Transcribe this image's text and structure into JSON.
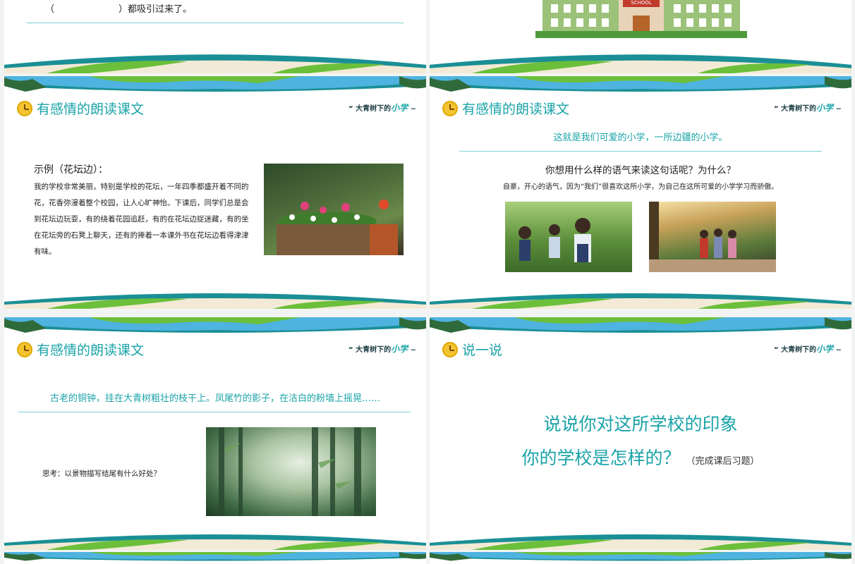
{
  "brand": {
    "prefix": "大青树下的",
    "accent": "小学"
  },
  "colors": {
    "teal": "#1aa3a8",
    "sky": "#4fb3e0",
    "leaf": "#6bbf3a",
    "sand": "#f2ead6"
  },
  "prev_slide": {
    "text": "（　　　　　　　）都吸引过来了。"
  },
  "slide1": {
    "title": "有感情的朗读课文",
    "example_title": "示例（花坛边）：",
    "example_body": "我的学校非常美丽，特别是学校的花坛，一年四季都盛开着不同的花，花香弥漫着整个校园，让人心旷神怡。下课后，同学们总是会到花坛边玩耍，有的绕着花园追赶，有的在花坛边捉迷藏，有的坐在花坛旁的石凳上聊天，还有的捧着一本课外书在花坛边看得津津有味。"
  },
  "slide2": {
    "title": "有感情的朗读课文",
    "quote": "这就是我们可爱的小学，一所边疆的小学。",
    "question": "你想用什么样的语气来读这句话呢？为什么？",
    "answer": "自豪，开心的语气，因为“我们”很喜欢这所小学，为自己在这所可爱的小学学习而骄傲。"
  },
  "slide3": {
    "title": "有感情的朗读课文",
    "sentence": "古老的铜钟，挂在大青树粗壮的枝干上。凤尾竹的影子，在洁白的粉墙上摇晃……",
    "think": "思考：以景物描写结尾有什么好处？"
  },
  "slide4": {
    "title": "说一说",
    "line1": "说说你对这所学校的印象",
    "line2": "你的学校是怎样的？",
    "note": "（完成课后习题）"
  },
  "school_sign": "SCHOOL"
}
